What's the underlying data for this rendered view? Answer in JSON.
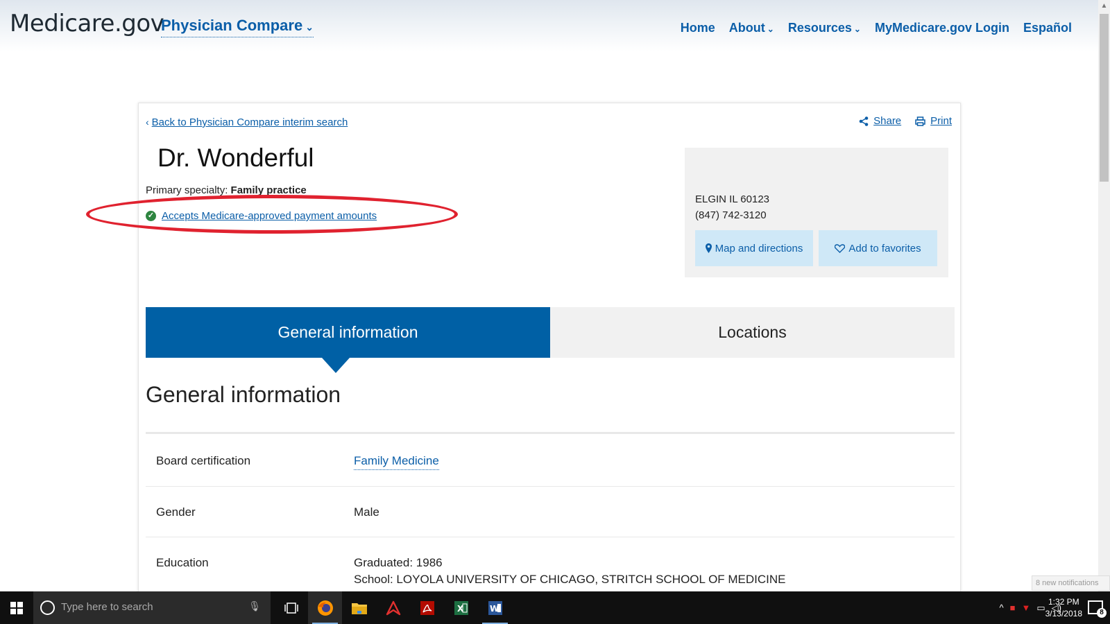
{
  "header": {
    "logo_main": "Medicare",
    "logo_suffix": ".gov",
    "product": "Physician Compare",
    "nav": {
      "home": "Home",
      "about": "About",
      "resources": "Resources",
      "login": "MyMedicare.gov Login",
      "espanol": "Español"
    }
  },
  "profile": {
    "back_link": "Back to Physician Compare interim search",
    "share": "Share",
    "print": "Print",
    "name": "Dr. Wonderful",
    "specialty_label": "Primary specialty:",
    "specialty_value": "Family practice",
    "accepts_label": "Accepts Medicare-approved payment amounts"
  },
  "address": {
    "city_line": "ELGIN IL 60123",
    "phone": "(847) 742-3120",
    "map_button": "Map and directions",
    "favorites_button": "Add to favorites"
  },
  "tabs": {
    "general": "General information",
    "locations": "Locations"
  },
  "general": {
    "title": "General information",
    "board_label": "Board certification",
    "board_value": "Family Medicine",
    "gender_label": "Gender",
    "gender_value": "Male",
    "education_label": "Education",
    "education_graduated": "Graduated: 1986",
    "education_school": "School: LOYOLA UNIVERSITY OF CHICAGO, STRITCH SCHOOL OF MEDICINE"
  },
  "notification_peek": "8 new notifications",
  "taskbar": {
    "search_placeholder": "Type here to search",
    "time": "1:32 PM",
    "date": "3/13/2018",
    "notification_count": "8"
  },
  "colors": {
    "brand_blue": "#0060a5",
    "link_blue": "#0b5ea8",
    "highlight_red": "#e0222f",
    "check_green": "#2e8540"
  }
}
